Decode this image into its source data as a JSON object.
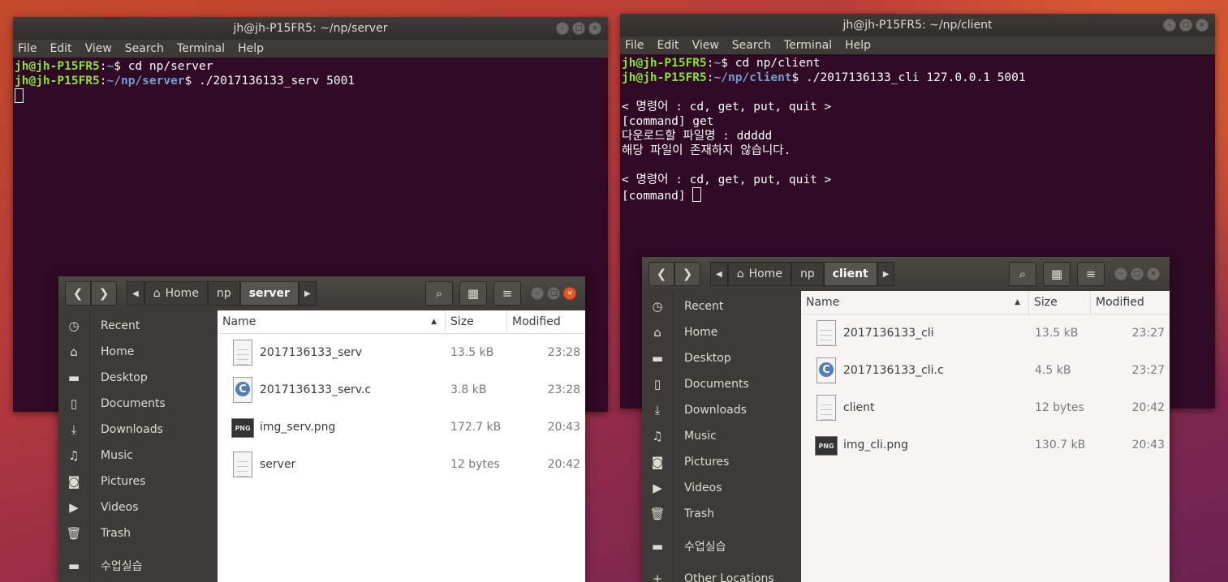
{
  "terminal_server": {
    "title": "jh@jh-P15FR5: ~/np/server",
    "menu": [
      "File",
      "Edit",
      "View",
      "Search",
      "Terminal",
      "Help"
    ],
    "line1_user": "jh@jh-P15FR5",
    "line1_sep": ":",
    "line1_path": "~",
    "line1_cmd": "$ cd np/server",
    "line2_user": "jh@jh-P15FR5",
    "line2_sep": ":",
    "line2_path": "~/np/server",
    "line2_cmd": "$ ./2017136133_serv 5001"
  },
  "terminal_client": {
    "title": "jh@jh-P15FR5: ~/np/client",
    "menu": [
      "File",
      "Edit",
      "View",
      "Search",
      "Terminal",
      "Help"
    ],
    "line1_user": "jh@jh-P15FR5",
    "line1_sep": ":",
    "line1_path": "~",
    "line1_cmd": "$ cd np/client",
    "line2_user": "jh@jh-P15FR5",
    "line2_sep": ":",
    "line2_path": "~/np/client",
    "line2_cmd": "$ ./2017136133_cli 127.0.0.1 5001",
    "output": [
      "",
      "< 명령어 : cd, get, put, quit >",
      "[command] get",
      "다운로드할 파일명 : ddddd",
      "해당 파일이 존재하지 않습니다.",
      "",
      "< 명령어 : cd, get, put, quit >"
    ],
    "prompt_last": "[command] "
  },
  "files_server": {
    "crumbs": [
      "Home",
      "np",
      "server"
    ],
    "sidebar": [
      "Recent",
      "Home",
      "Desktop",
      "Documents",
      "Downloads",
      "Music",
      "Pictures",
      "Videos",
      "Trash",
      "수업실습"
    ],
    "columns": {
      "name": "Name",
      "size": "Size",
      "modified": "Modified"
    },
    "rows": [
      {
        "name": "2017136133_serv",
        "size": "13.5 kB",
        "modified": "23:28",
        "icon": "document-icon"
      },
      {
        "name": "2017136133_serv.c",
        "size": "3.8 kB",
        "modified": "23:28",
        "icon": "c-source-icon"
      },
      {
        "name": "img_serv.png",
        "size": "172.7 kB",
        "modified": "20:43",
        "icon": "png-icon"
      },
      {
        "name": "server",
        "size": "12 bytes",
        "modified": "20:42",
        "icon": "document-icon"
      }
    ]
  },
  "files_client": {
    "crumbs": [
      "Home",
      "np",
      "client"
    ],
    "sidebar": [
      "Recent",
      "Home",
      "Desktop",
      "Documents",
      "Downloads",
      "Music",
      "Pictures",
      "Videos",
      "Trash",
      "수업실습",
      "Other Locations"
    ],
    "columns": {
      "name": "Name",
      "size": "Size",
      "modified": "Modified"
    },
    "rows": [
      {
        "name": "2017136133_cli",
        "size": "13.5 kB",
        "modified": "23:27",
        "icon": "document-icon"
      },
      {
        "name": "2017136133_cli.c",
        "size": "4.5 kB",
        "modified": "23:27",
        "icon": "c-source-icon"
      },
      {
        "name": "client",
        "size": "12 bytes",
        "modified": "20:42",
        "icon": "document-icon"
      },
      {
        "name": "img_cli.png",
        "size": "130.7 kB",
        "modified": "20:43",
        "icon": "png-icon"
      }
    ]
  },
  "icons": {
    "png_label": "PNG",
    "c_label": "C"
  }
}
